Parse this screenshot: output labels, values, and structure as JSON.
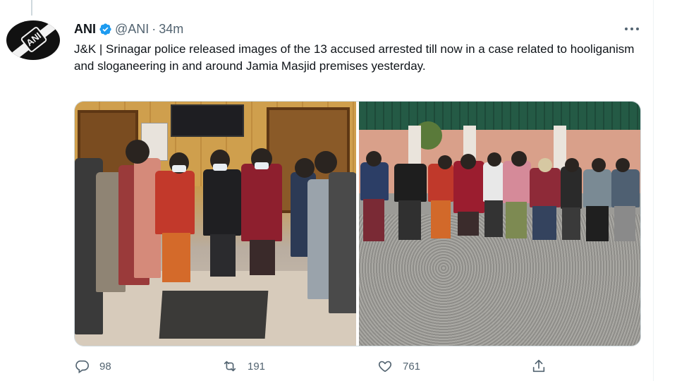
{
  "tweet": {
    "author_name": "ANI",
    "handle": "@ANI",
    "separator": "·",
    "time": "34m",
    "avatar_text": "ANI",
    "text": "J&K | Srinagar police released images of the 13 accused arrested till now in a case related to hooliganism and sloganeering in and around Jamia Masjid premises yesterday."
  },
  "media": {
    "left_photo": "police-station-room-accused-standing",
    "right_photo": "outdoor-gravel-yard-accused-standing"
  },
  "actions": {
    "reply_count": "98",
    "retweet_count": "191",
    "like_count": "761"
  },
  "icons": {
    "more": "more-horizontal-icon",
    "verified": "verified-badge-icon",
    "reply": "reply-icon",
    "retweet": "retweet-icon",
    "like": "heart-icon",
    "share": "share-icon"
  },
  "colors": {
    "verified_blue": "#1d9bf0",
    "secondary_text": "#536471",
    "primary_text": "#0f1419"
  }
}
